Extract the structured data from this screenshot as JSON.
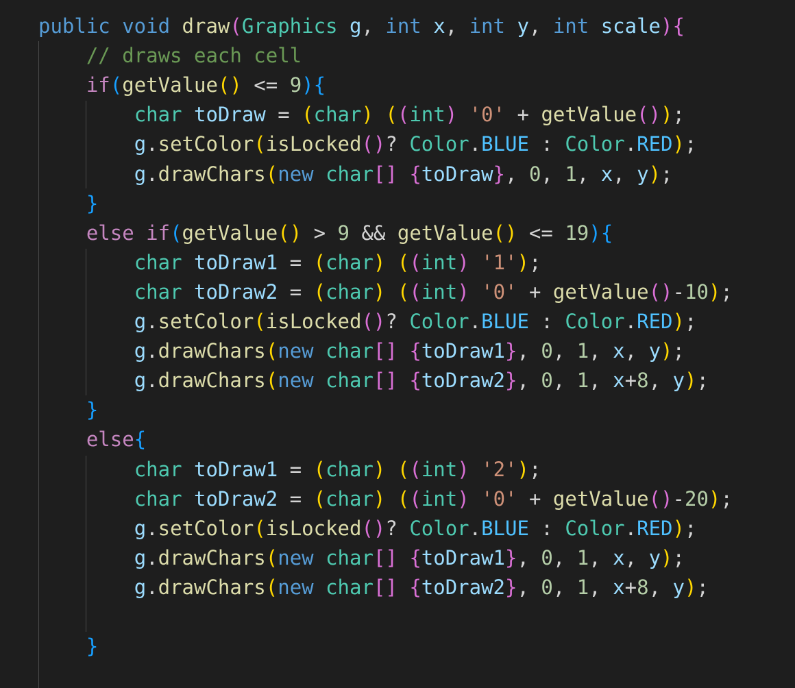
{
  "editor": {
    "language": "java",
    "theme_colors": {
      "background": "#1e1e1e",
      "keyword": "#569cd6",
      "control": "#c586c0",
      "function": "#dcdcaa",
      "type": "#4ec9b0",
      "variable": "#9cdcfe",
      "constant": "#4fc1ff",
      "number": "#b5cea8",
      "string": "#ce9178",
      "comment": "#6a9955",
      "bracket_1": "#ffd700",
      "bracket_2": "#da70d6",
      "bracket_3": "#179fff"
    },
    "lines": [
      [
        [
          "kw",
          "public "
        ],
        [
          "kw",
          "void "
        ],
        [
          "fn",
          "draw"
        ],
        [
          "b2",
          "("
        ],
        [
          "type",
          "Graphics "
        ],
        [
          "var",
          "g"
        ],
        [
          "p",
          ", "
        ],
        [
          "kw",
          "int "
        ],
        [
          "var",
          "x"
        ],
        [
          "p",
          ", "
        ],
        [
          "kw",
          "int "
        ],
        [
          "var",
          "y"
        ],
        [
          "p",
          ", "
        ],
        [
          "kw",
          "int "
        ],
        [
          "var",
          "scale"
        ],
        [
          "b2",
          ")"
        ],
        [
          "b2",
          "{"
        ]
      ],
      [
        [
          "p",
          "    "
        ],
        [
          "cmt",
          "// draws each cell"
        ]
      ],
      [
        [
          "p",
          "    "
        ],
        [
          "ctl",
          "if"
        ],
        [
          "b3",
          "("
        ],
        [
          "fn",
          "getValue"
        ],
        [
          "b1",
          "()"
        ],
        [
          "p",
          " <= "
        ],
        [
          "num",
          "9"
        ],
        [
          "b3",
          ")"
        ],
        [
          "b3",
          "{"
        ]
      ],
      [
        [
          "p",
          "        "
        ],
        [
          "type",
          "char "
        ],
        [
          "var",
          "toDraw"
        ],
        [
          "p",
          " = "
        ],
        [
          "b1",
          "("
        ],
        [
          "type",
          "char"
        ],
        [
          "b1",
          ")"
        ],
        [
          "p",
          " "
        ],
        [
          "b1",
          "("
        ],
        [
          "b2",
          "("
        ],
        [
          "type",
          "int"
        ],
        [
          "b2",
          ")"
        ],
        [
          "p",
          " "
        ],
        [
          "str",
          "'0'"
        ],
        [
          "p",
          " + "
        ],
        [
          "fn",
          "getValue"
        ],
        [
          "b2",
          "()"
        ],
        [
          "b1",
          ")"
        ],
        [
          "p",
          ";"
        ]
      ],
      [
        [
          "p",
          "        "
        ],
        [
          "var",
          "g"
        ],
        [
          "p",
          "."
        ],
        [
          "fn",
          "setColor"
        ],
        [
          "b1",
          "("
        ],
        [
          "fn",
          "isLocked"
        ],
        [
          "b2",
          "()"
        ],
        [
          "p",
          "? "
        ],
        [
          "type",
          "Color"
        ],
        [
          "p",
          "."
        ],
        [
          "const",
          "BLUE"
        ],
        [
          "p",
          " : "
        ],
        [
          "type",
          "Color"
        ],
        [
          "p",
          "."
        ],
        [
          "const",
          "RED"
        ],
        [
          "b1",
          ")"
        ],
        [
          "p",
          ";"
        ]
      ],
      [
        [
          "p",
          "        "
        ],
        [
          "var",
          "g"
        ],
        [
          "p",
          "."
        ],
        [
          "fn",
          "drawChars"
        ],
        [
          "b1",
          "("
        ],
        [
          "kw",
          "new "
        ],
        [
          "type",
          "char"
        ],
        [
          "b2",
          "[]"
        ],
        [
          "p",
          " "
        ],
        [
          "b2",
          "{"
        ],
        [
          "var",
          "toDraw"
        ],
        [
          "b2",
          "}"
        ],
        [
          "p",
          ", "
        ],
        [
          "num",
          "0"
        ],
        [
          "p",
          ", "
        ],
        [
          "num",
          "1"
        ],
        [
          "p",
          ", "
        ],
        [
          "var",
          "x"
        ],
        [
          "p",
          ", "
        ],
        [
          "var",
          "y"
        ],
        [
          "b1",
          ")"
        ],
        [
          "p",
          ";"
        ]
      ],
      [
        [
          "p",
          "    "
        ],
        [
          "b3",
          "}"
        ]
      ],
      [
        [
          "p",
          "    "
        ],
        [
          "ctl",
          "else "
        ],
        [
          "ctl",
          "if"
        ],
        [
          "b3",
          "("
        ],
        [
          "fn",
          "getValue"
        ],
        [
          "b1",
          "()"
        ],
        [
          "p",
          " > "
        ],
        [
          "num",
          "9"
        ],
        [
          "p",
          " && "
        ],
        [
          "fn",
          "getValue"
        ],
        [
          "b1",
          "()"
        ],
        [
          "p",
          " <= "
        ],
        [
          "num",
          "19"
        ],
        [
          "b3",
          ")"
        ],
        [
          "b3",
          "{"
        ]
      ],
      [
        [
          "p",
          "        "
        ],
        [
          "type",
          "char "
        ],
        [
          "var",
          "toDraw1"
        ],
        [
          "p",
          " = "
        ],
        [
          "b1",
          "("
        ],
        [
          "type",
          "char"
        ],
        [
          "b1",
          ")"
        ],
        [
          "p",
          " "
        ],
        [
          "b1",
          "("
        ],
        [
          "b2",
          "("
        ],
        [
          "type",
          "int"
        ],
        [
          "b2",
          ")"
        ],
        [
          "p",
          " "
        ],
        [
          "str",
          "'1'"
        ],
        [
          "b1",
          ")"
        ],
        [
          "p",
          ";"
        ]
      ],
      [
        [
          "p",
          "        "
        ],
        [
          "type",
          "char "
        ],
        [
          "var",
          "toDraw2"
        ],
        [
          "p",
          " = "
        ],
        [
          "b1",
          "("
        ],
        [
          "type",
          "char"
        ],
        [
          "b1",
          ")"
        ],
        [
          "p",
          " "
        ],
        [
          "b1",
          "("
        ],
        [
          "b2",
          "("
        ],
        [
          "type",
          "int"
        ],
        [
          "b2",
          ")"
        ],
        [
          "p",
          " "
        ],
        [
          "str",
          "'0'"
        ],
        [
          "p",
          " + "
        ],
        [
          "fn",
          "getValue"
        ],
        [
          "b2",
          "()"
        ],
        [
          "p",
          "-"
        ],
        [
          "num",
          "10"
        ],
        [
          "b1",
          ")"
        ],
        [
          "p",
          ";"
        ]
      ],
      [
        [
          "p",
          "        "
        ],
        [
          "var",
          "g"
        ],
        [
          "p",
          "."
        ],
        [
          "fn",
          "setColor"
        ],
        [
          "b1",
          "("
        ],
        [
          "fn",
          "isLocked"
        ],
        [
          "b2",
          "()"
        ],
        [
          "p",
          "? "
        ],
        [
          "type",
          "Color"
        ],
        [
          "p",
          "."
        ],
        [
          "const",
          "BLUE"
        ],
        [
          "p",
          " : "
        ],
        [
          "type",
          "Color"
        ],
        [
          "p",
          "."
        ],
        [
          "const",
          "RED"
        ],
        [
          "b1",
          ")"
        ],
        [
          "p",
          ";"
        ]
      ],
      [
        [
          "p",
          "        "
        ],
        [
          "var",
          "g"
        ],
        [
          "p",
          "."
        ],
        [
          "fn",
          "drawChars"
        ],
        [
          "b1",
          "("
        ],
        [
          "kw",
          "new "
        ],
        [
          "type",
          "char"
        ],
        [
          "b2",
          "[]"
        ],
        [
          "p",
          " "
        ],
        [
          "b2",
          "{"
        ],
        [
          "var",
          "toDraw1"
        ],
        [
          "b2",
          "}"
        ],
        [
          "p",
          ", "
        ],
        [
          "num",
          "0"
        ],
        [
          "p",
          ", "
        ],
        [
          "num",
          "1"
        ],
        [
          "p",
          ", "
        ],
        [
          "var",
          "x"
        ],
        [
          "p",
          ", "
        ],
        [
          "var",
          "y"
        ],
        [
          "b1",
          ")"
        ],
        [
          "p",
          ";"
        ]
      ],
      [
        [
          "p",
          "        "
        ],
        [
          "var",
          "g"
        ],
        [
          "p",
          "."
        ],
        [
          "fn",
          "drawChars"
        ],
        [
          "b1",
          "("
        ],
        [
          "kw",
          "new "
        ],
        [
          "type",
          "char"
        ],
        [
          "b2",
          "[]"
        ],
        [
          "p",
          " "
        ],
        [
          "b2",
          "{"
        ],
        [
          "var",
          "toDraw2"
        ],
        [
          "b2",
          "}"
        ],
        [
          "p",
          ", "
        ],
        [
          "num",
          "0"
        ],
        [
          "p",
          ", "
        ],
        [
          "num",
          "1"
        ],
        [
          "p",
          ", "
        ],
        [
          "var",
          "x"
        ],
        [
          "p",
          "+"
        ],
        [
          "num",
          "8"
        ],
        [
          "p",
          ", "
        ],
        [
          "var",
          "y"
        ],
        [
          "b1",
          ")"
        ],
        [
          "p",
          ";"
        ]
      ],
      [
        [
          "p",
          "    "
        ],
        [
          "b3",
          "}"
        ]
      ],
      [
        [
          "p",
          "    "
        ],
        [
          "ctl",
          "else"
        ],
        [
          "b3",
          "{"
        ]
      ],
      [
        [
          "p",
          "        "
        ],
        [
          "type",
          "char "
        ],
        [
          "var",
          "toDraw1"
        ],
        [
          "p",
          " = "
        ],
        [
          "b1",
          "("
        ],
        [
          "type",
          "char"
        ],
        [
          "b1",
          ")"
        ],
        [
          "p",
          " "
        ],
        [
          "b1",
          "("
        ],
        [
          "b2",
          "("
        ],
        [
          "type",
          "int"
        ],
        [
          "b2",
          ")"
        ],
        [
          "p",
          " "
        ],
        [
          "str",
          "'2'"
        ],
        [
          "b1",
          ")"
        ],
        [
          "p",
          ";"
        ]
      ],
      [
        [
          "p",
          "        "
        ],
        [
          "type",
          "char "
        ],
        [
          "var",
          "toDraw2"
        ],
        [
          "p",
          " = "
        ],
        [
          "b1",
          "("
        ],
        [
          "type",
          "char"
        ],
        [
          "b1",
          ")"
        ],
        [
          "p",
          " "
        ],
        [
          "b1",
          "("
        ],
        [
          "b2",
          "("
        ],
        [
          "type",
          "int"
        ],
        [
          "b2",
          ")"
        ],
        [
          "p",
          " "
        ],
        [
          "str",
          "'0'"
        ],
        [
          "p",
          " + "
        ],
        [
          "fn",
          "getValue"
        ],
        [
          "b2",
          "()"
        ],
        [
          "p",
          "-"
        ],
        [
          "num",
          "20"
        ],
        [
          "b1",
          ")"
        ],
        [
          "p",
          ";"
        ]
      ],
      [
        [
          "p",
          "        "
        ],
        [
          "var",
          "g"
        ],
        [
          "p",
          "."
        ],
        [
          "fn",
          "setColor"
        ],
        [
          "b1",
          "("
        ],
        [
          "fn",
          "isLocked"
        ],
        [
          "b2",
          "()"
        ],
        [
          "p",
          "? "
        ],
        [
          "type",
          "Color"
        ],
        [
          "p",
          "."
        ],
        [
          "const",
          "BLUE"
        ],
        [
          "p",
          " : "
        ],
        [
          "type",
          "Color"
        ],
        [
          "p",
          "."
        ],
        [
          "const",
          "RED"
        ],
        [
          "b1",
          ")"
        ],
        [
          "p",
          ";"
        ]
      ],
      [
        [
          "p",
          "        "
        ],
        [
          "var",
          "g"
        ],
        [
          "p",
          "."
        ],
        [
          "fn",
          "drawChars"
        ],
        [
          "b1",
          "("
        ],
        [
          "kw",
          "new "
        ],
        [
          "type",
          "char"
        ],
        [
          "b2",
          "[]"
        ],
        [
          "p",
          " "
        ],
        [
          "b2",
          "{"
        ],
        [
          "var",
          "toDraw1"
        ],
        [
          "b2",
          "}"
        ],
        [
          "p",
          ", "
        ],
        [
          "num",
          "0"
        ],
        [
          "p",
          ", "
        ],
        [
          "num",
          "1"
        ],
        [
          "p",
          ", "
        ],
        [
          "var",
          "x"
        ],
        [
          "p",
          ", "
        ],
        [
          "var",
          "y"
        ],
        [
          "b1",
          ")"
        ],
        [
          "p",
          ";"
        ]
      ],
      [
        [
          "p",
          "        "
        ],
        [
          "var",
          "g"
        ],
        [
          "p",
          "."
        ],
        [
          "fn",
          "drawChars"
        ],
        [
          "b1",
          "("
        ],
        [
          "kw",
          "new "
        ],
        [
          "type",
          "char"
        ],
        [
          "b2",
          "[]"
        ],
        [
          "p",
          " "
        ],
        [
          "b2",
          "{"
        ],
        [
          "var",
          "toDraw2"
        ],
        [
          "b2",
          "}"
        ],
        [
          "p",
          ", "
        ],
        [
          "num",
          "0"
        ],
        [
          "p",
          ", "
        ],
        [
          "num",
          "1"
        ],
        [
          "p",
          ", "
        ],
        [
          "var",
          "x"
        ],
        [
          "p",
          "+"
        ],
        [
          "num",
          "8"
        ],
        [
          "p",
          ", "
        ],
        [
          "var",
          "y"
        ],
        [
          "b1",
          ")"
        ],
        [
          "p",
          ";"
        ]
      ],
      [
        [
          "p",
          ""
        ]
      ],
      [
        [
          "p",
          "    "
        ],
        [
          "b3",
          "}"
        ]
      ]
    ]
  }
}
